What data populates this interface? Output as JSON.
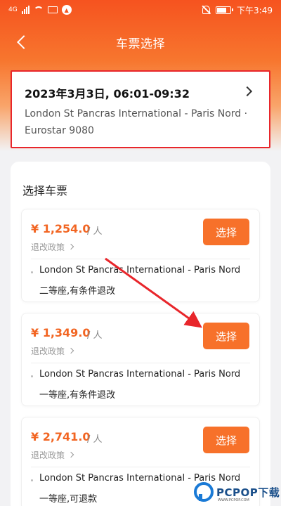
{
  "status_bar": {
    "network": "4G",
    "time": "下午3:49",
    "icons": [
      "signal-icon",
      "wifi-icon",
      "mail-icon",
      "app-badge-icon",
      "mute-icon",
      "battery-icon"
    ]
  },
  "nav": {
    "back_icon": "chevron-left-icon",
    "title": "车票选择"
  },
  "trip": {
    "datetime": "2023年3月3日, 06:01-09:32",
    "route": "London St Pancras International - Paris Nord · Eurostar 9080"
  },
  "panel": {
    "title": "选择车票"
  },
  "tickets": [
    {
      "price": "¥ 1,254.0",
      "unit": "/ 人",
      "policy": "退改政策",
      "button": "选择",
      "route": "London St Pancras International - Paris Nord",
      "seat": "二等座,有条件退改"
    },
    {
      "price": "¥ 1,349.0",
      "unit": "/ 人",
      "policy": "退改政策",
      "button": "选择",
      "route": "London St Pancras International - Paris Nord",
      "seat": "一等座,有条件退改"
    },
    {
      "price": "¥ 2,741.0",
      "unit": "/ 人",
      "policy": "退改政策",
      "button": "选择",
      "route": "London St Pancras International - Paris Nord",
      "seat": "一等座,可退款"
    }
  ],
  "watermark": {
    "text": "PCPOP下载",
    "subtext": "WWW.PCPOP.COM"
  },
  "colors": {
    "accent": "#f7712a",
    "price": "#f26522",
    "highlight": "#e8262b"
  }
}
